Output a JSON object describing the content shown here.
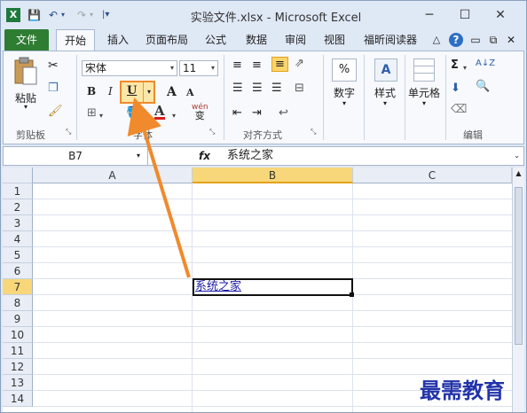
{
  "window": {
    "title": "实验文件.xlsx - Microsoft Excel",
    "app_icon": "X",
    "controls": {
      "minimize": "─",
      "maximize": "☐",
      "close": "✕"
    }
  },
  "quick_access": {
    "save": "💾",
    "undo": "↶",
    "undo_arrow": "▾",
    "redo": "↷",
    "redo_arrow": "▾",
    "customize": "|▾"
  },
  "tabs": [
    {
      "label": "文件"
    },
    {
      "label": "开始"
    },
    {
      "label": "插入"
    },
    {
      "label": "页面布局"
    },
    {
      "label": "公式"
    },
    {
      "label": "数据"
    },
    {
      "label": "审阅"
    },
    {
      "label": "视图"
    },
    {
      "label": "福昕阅读器"
    }
  ],
  "tab_right_icons": {
    "collapse": "△",
    "help": "?",
    "min": "▭",
    "restore": "⧉",
    "close": "✕"
  },
  "ribbon": {
    "clipboard": {
      "paste": "粘贴",
      "group": "剪贴板"
    },
    "font": {
      "name": "宋体",
      "size": "11",
      "bold": "B",
      "italic": "I",
      "underline": "U",
      "grow": "A",
      "shrink": "A",
      "color_letter": "A",
      "wen": "wén",
      "wen_char": "变",
      "group": "字体"
    },
    "alignment": {
      "group": "对齐方式"
    },
    "number": {
      "percent": "%",
      "label": "数字"
    },
    "styles": {
      "label": "样式"
    },
    "cells": {
      "label": "单元格"
    },
    "editing": {
      "sigma": "Σ",
      "sort": "A↓Z",
      "find": "A",
      "group": "编辑"
    }
  },
  "formula_bar": {
    "namebox": "B7",
    "fx": "fx",
    "content": "系统之家"
  },
  "columns": [
    "A",
    "B",
    "C"
  ],
  "rows": [
    "1",
    "2",
    "3",
    "4",
    "5",
    "6",
    "7",
    "8",
    "9",
    "10",
    "11",
    "12",
    "13",
    "14"
  ],
  "selected_cell": {
    "column": "B",
    "row": "7",
    "value": "系统之家"
  },
  "watermark": "最需教育",
  "colors": {
    "file_tab": "#2f7d32",
    "highlight": "#f08a2c",
    "selection_header": "#f7d77a"
  }
}
